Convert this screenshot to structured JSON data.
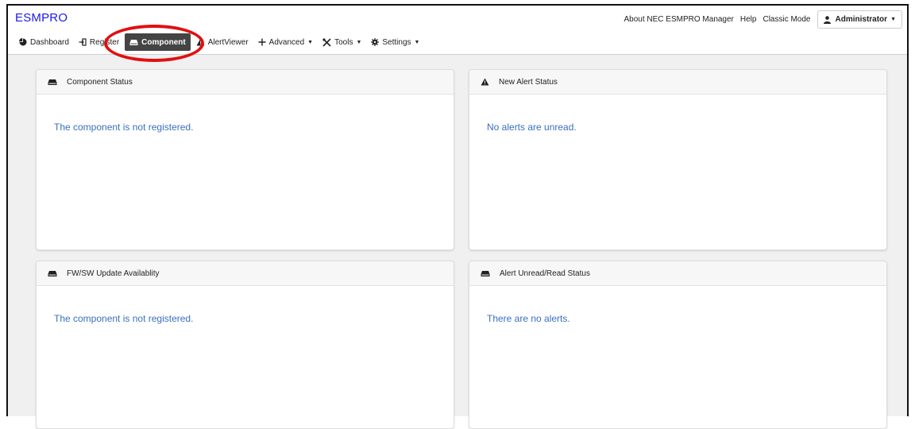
{
  "app": {
    "logo": "ESMPRO"
  },
  "nav": {
    "items": [
      {
        "label": "Dashboard",
        "icon": "dashboard-icon",
        "active": false,
        "dropdown": false
      },
      {
        "label": "Register",
        "icon": "register-icon",
        "active": false,
        "dropdown": false
      },
      {
        "label": "Component",
        "icon": "component-icon",
        "active": true,
        "dropdown": false
      },
      {
        "label": "AlertViewer",
        "icon": "alert-icon",
        "active": false,
        "dropdown": false
      },
      {
        "label": "Advanced",
        "icon": "plus-icon",
        "active": false,
        "dropdown": true
      },
      {
        "label": "Tools",
        "icon": "tools-icon",
        "active": false,
        "dropdown": true
      },
      {
        "label": "Settings",
        "icon": "gear-icon",
        "active": false,
        "dropdown": true
      }
    ]
  },
  "right_menu": {
    "about": "About NEC ESMPRO Manager",
    "help": "Help",
    "classic": "Classic Mode",
    "user": "Administrator"
  },
  "cards": [
    {
      "title": "Component Status",
      "icon": "component-icon",
      "message": "The component is not registered."
    },
    {
      "title": "New Alert Status",
      "icon": "warning-icon",
      "message": "No alerts are unread."
    },
    {
      "title": "FW/SW Update Availablity",
      "icon": "component-icon",
      "message": "The component is not registered."
    },
    {
      "title": "Alert Unread/Read Status",
      "icon": "component-icon",
      "message": "There are no alerts."
    }
  ],
  "colors": {
    "logo": "#1a1ae6",
    "active_tab": "#444444",
    "message": "#3a6fbf",
    "highlight": "#e01010"
  }
}
